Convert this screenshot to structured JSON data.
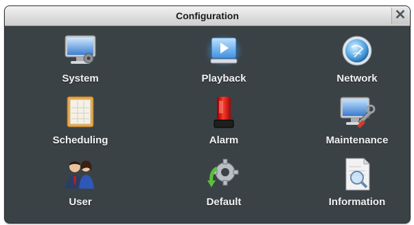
{
  "window": {
    "title": "Configuration",
    "close_glyph": "✕"
  },
  "menu": {
    "items": [
      {
        "label": "System",
        "icon": "monitor-gear-icon"
      },
      {
        "label": "Playback",
        "icon": "play-icon"
      },
      {
        "label": "Network",
        "icon": "network-globe-icon"
      },
      {
        "label": "Scheduling",
        "icon": "calendar-icon"
      },
      {
        "label": "Alarm",
        "icon": "siren-icon"
      },
      {
        "label": "Maintenance",
        "icon": "wrench-monitor-icon"
      },
      {
        "label": "User",
        "icon": "users-icon"
      },
      {
        "label": "Default",
        "icon": "reset-gear-icon"
      },
      {
        "label": "Information",
        "icon": "document-search-icon"
      }
    ]
  },
  "colors": {
    "panel_bg": "#3b4246",
    "label_text": "#f2f2f2",
    "accent_blue": "#2f8fe0"
  }
}
